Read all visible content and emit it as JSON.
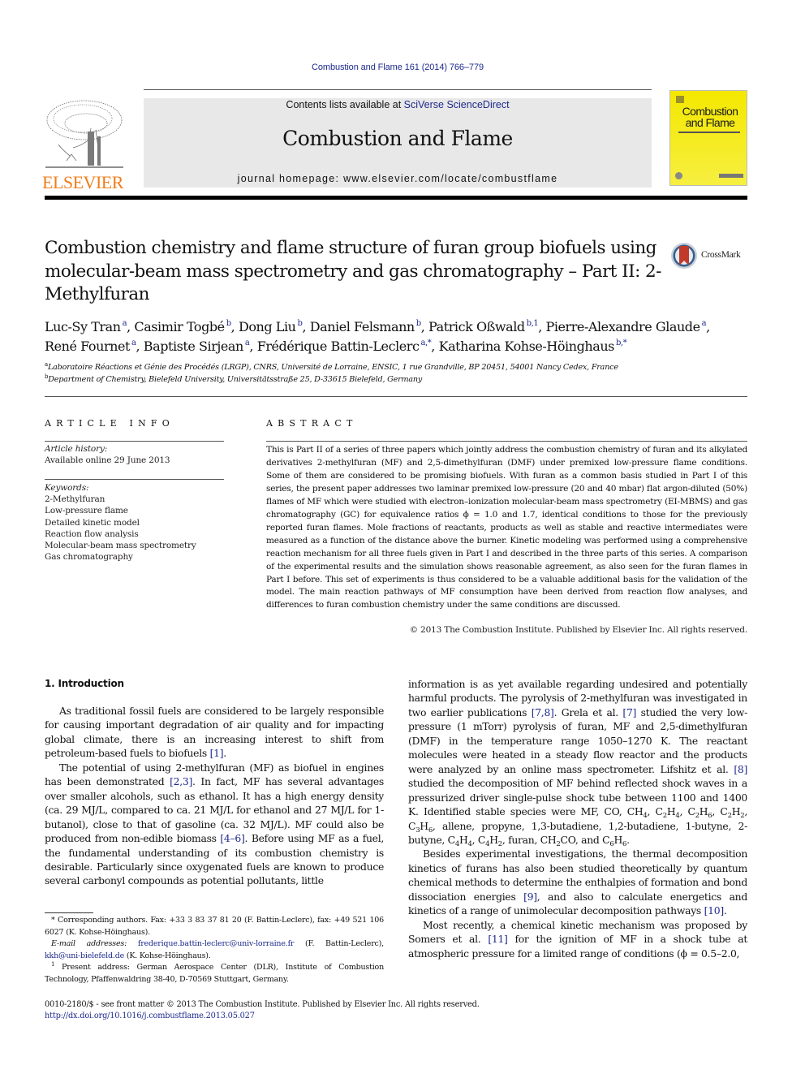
{
  "header": {
    "citation": "Combustion and Flame 161 (2014) 766–779",
    "contents_prefix": "Contents lists available at ",
    "contents_link": "SciVerse ScienceDirect",
    "journal_name": "Combustion and Flame",
    "homepage": "journal homepage: www.elsevier.com/locate/combustflame",
    "publisher_logo_text": "ELSEVIER",
    "cover_title": "Combustion and Flame",
    "colors": {
      "brand_orange": "#f07d1a",
      "link_blue": "#1e2a8c",
      "cover_yellow": "#f4e800",
      "banner_gray": "#e8e8e8"
    }
  },
  "article": {
    "title": "Combustion chemistry and flame structure of furan group biofuels using molecular-beam mass spectrometry and gas chromatography – Part II: 2-Methylfuran",
    "crossmark_label": "CrossMark",
    "authors": [
      {
        "name": "Luc-Sy Tran",
        "sup": "a",
        "sep": ", "
      },
      {
        "name": "Casimir Togbé",
        "sup": "b",
        "sep": ", "
      },
      {
        "name": "Dong Liu",
        "sup": "b",
        "sep": ", "
      },
      {
        "name": "Daniel Felsmann",
        "sup": "b",
        "sep": ", "
      },
      {
        "name": "Patrick Oßwald",
        "sup": "b,1",
        "sep": ", "
      },
      {
        "name": "Pierre-Alexandre Glaude",
        "sup": "a",
        "sep": ","
      },
      {
        "name": "René Fournet",
        "sup": "a",
        "sep": ", "
      },
      {
        "name": "Baptiste Sirjean",
        "sup": "a",
        "sep": ", "
      },
      {
        "name": "Frédérique Battin-Leclerc",
        "sup": "a,*",
        "sep": ", "
      },
      {
        "name": "Katharina Kohse-Höinghaus",
        "sup": "b,*",
        "sep": ""
      }
    ],
    "affiliations": [
      {
        "mark": "a",
        "text": "Laboratoire Réactions et Génie des Procédés (LRGP), CNRS, Université de Lorraine, ENSIC, 1 rue Grandville, BP 20451, 54001 Nancy Cedex, France"
      },
      {
        "mark": "b",
        "text": "Department of Chemistry, Bielefeld University, Universitätsstraße 25, D-33615 Bielefeld, Germany"
      }
    ]
  },
  "article_info": {
    "heading": "ARTICLE INFO",
    "history_label": "Article history:",
    "history_value": "Available online 29 June 2013",
    "keywords_label": "Keywords:",
    "keywords": [
      "2-Methylfuran",
      "Low-pressure flame",
      "Detailed kinetic model",
      "Reaction flow analysis",
      "Molecular-beam mass spectrometry",
      "Gas chromatography"
    ]
  },
  "abstract": {
    "heading": "ABSTRACT",
    "text": "This is Part II of a series of three papers which jointly address the combustion chemistry of furan and its alkylated derivatives 2-methylfuran (MF) and 2,5-dimethylfuran (DMF) under premixed low-pressure flame conditions. Some of them are considered to be promising biofuels. With furan as a common basis studied in Part I of this series, the present paper addresses two laminar premixed low-pressure (20 and 40 mbar) flat argon-diluted (50%) flames of MF which were studied with electron–ionization molecular-beam mass spectrometry (EI-MBMS) and gas chromatography (GC) for equivalence ratios ϕ = 1.0 and 1.7, identical conditions to those for the previously reported furan flames. Mole fractions of reactants, products as well as stable and reactive intermediates were measured as a function of the distance above the burner. Kinetic modeling was performed using a comprehensive reaction mechanism for all three fuels given in Part I and described in the three parts of this series. A comparison of the experimental results and the simulation shows reasonable agreement, as also seen for the furan flames in Part I before. This set of experiments is thus considered to be a valuable additional basis for the validation of the model. The main reaction pathways of MF consumption have been derived from reaction flow analyses, and differences to furan combustion chemistry under the same conditions are discussed.",
    "copyright": "© 2013 The Combustion Institute. Published by Elsevier Inc. All rights reserved."
  },
  "body": {
    "section_title": "1. Introduction",
    "left_paragraphs": [
      [
        {
          "t": "As traditional fossil fuels are considered to be largely responsible for causing important degradation of air quality and for impacting global climate, there is an increasing interest to shift from petroleum-based fuels to biofuels "
        },
        {
          "ref": "[1]"
        },
        {
          "t": "."
        }
      ],
      [
        {
          "t": "The potential of using 2-methylfuran (MF) as biofuel in engines has been demonstrated "
        },
        {
          "ref": "[2,3]"
        },
        {
          "t": ". In fact, MF has several advantages over smaller alcohols, such as ethanol. It has a high energy density (ca. 29 MJ/L, compared to ca. 21 MJ/L for ethanol and 27 MJ/L for 1-butanol), close to that of gasoline (ca. 32 MJ/L). MF could also be produced from non-edible biomass "
        },
        {
          "ref": "[4–6]"
        },
        {
          "t": ". Before using MF as a fuel, the fundamental understanding of its combustion chemistry is desirable. Particularly since oxygenated fuels are known to produce several carbonyl compounds as potential pollutants, little"
        }
      ]
    ],
    "right_paragraphs": [
      {
        "noindent": true,
        "parts": [
          {
            "t": "information is as yet available regarding undesired and potentially harmful products. The pyrolysis of 2-methylfuran was investigated in two earlier publications "
          },
          {
            "ref": "[7,8]"
          },
          {
            "t": ". Grela et al. "
          },
          {
            "ref": "[7]"
          },
          {
            "t": " studied the very low-pressure (1 mTorr) pyrolysis of furan, MF and 2,5-dimethylfuran (DMF) in the temperature range 1050–1270 K. The reactant molecules were heated in a steady flow reactor and the products were analyzed by an online mass spectrometer. Lifshitz et al. "
          },
          {
            "ref": "[8]"
          },
          {
            "t": " studied the decomposition of MF behind reflected shock waves in a pressurized driver single-pulse shock tube between 1100 and 1400 K. Identified stable species were MF, CO, CH"
          },
          {
            "sub": "4"
          },
          {
            "t": ", C"
          },
          {
            "sub": "2"
          },
          {
            "t": "H"
          },
          {
            "sub": "4"
          },
          {
            "t": ", C"
          },
          {
            "sub": "2"
          },
          {
            "t": "H"
          },
          {
            "sub": "6"
          },
          {
            "t": ", C"
          },
          {
            "sub": "2"
          },
          {
            "t": "H"
          },
          {
            "sub": "2"
          },
          {
            "t": ", C"
          },
          {
            "sub": "3"
          },
          {
            "t": "H"
          },
          {
            "sub": "6"
          },
          {
            "t": ", allene, propyne, 1,3-butadiene, 1,2-butadiene, 1-butyne, 2-butyne, C"
          },
          {
            "sub": "4"
          },
          {
            "t": "H"
          },
          {
            "sub": "4"
          },
          {
            "t": ", C"
          },
          {
            "sub": "4"
          },
          {
            "t": "H"
          },
          {
            "sub": "2"
          },
          {
            "t": ", furan, CH"
          },
          {
            "sub": "2"
          },
          {
            "t": "CO, and C"
          },
          {
            "sub": "6"
          },
          {
            "t": "H"
          },
          {
            "sub": "6"
          },
          {
            "t": "."
          }
        ]
      },
      {
        "noindent": false,
        "parts": [
          {
            "t": "Besides experimental investigations, the thermal decomposition kinetics of furans has also been studied theoretically by quantum chemical methods to determine the enthalpies of formation and bond dissociation energies "
          },
          {
            "ref": "[9]"
          },
          {
            "t": ", and also to calculate energetics and kinetics of a range of unimolecular decomposition pathways "
          },
          {
            "ref": "[10]"
          },
          {
            "t": "."
          }
        ]
      },
      {
        "noindent": false,
        "parts": [
          {
            "t": "Most recently, a chemical kinetic mechanism was proposed by Somers et al. "
          },
          {
            "ref": "[11]"
          },
          {
            "t": " for the ignition of MF in a shock tube at atmospheric pressure for a limited range of conditions (ϕ = 0.5–2.0,"
          }
        ]
      }
    ]
  },
  "footnotes": {
    "corresponding": "* Corresponding authors. Fax: +33 3 83 37 81 20 (F. Battin-Leclerc), fax: +49 521 106 6027 (K. Kohse-Höinghaus).",
    "email_label": "E-mail addresses:",
    "email_1": "frederique.battin-leclerc@univ-lorraine.fr",
    "email_1_who": " (F. Battin-Leclerc),",
    "email_2": "kkh@uni-bielefeld.de",
    "email_2_who": " (K. Kohse-Höinghaus).",
    "present_mark": "1",
    "present_address": " Present address: German Aerospace Center (DLR), Institute of Combustion Technology, Pfaffenwaldring 38-40, D-70569 Stuttgart, Germany."
  },
  "bottom": {
    "issn_line": "0010-2180/$ - see front matter © 2013 The Combustion Institute. Published by Elsevier Inc. All rights reserved.",
    "doi": "http://dx.doi.org/10.1016/j.combustflame.2013.05.027"
  }
}
